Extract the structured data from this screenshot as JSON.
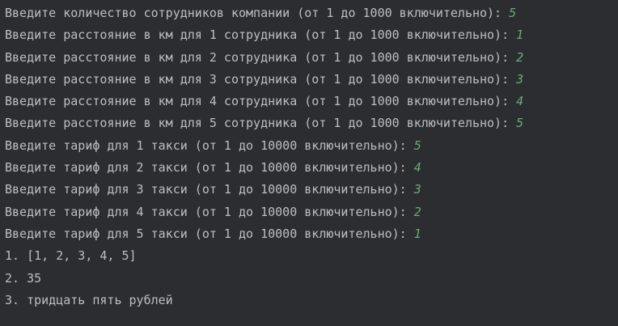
{
  "console": {
    "lines": [
      {
        "prompt": "Введите количество сотрудников компании (от 1 до 1000 включительно): ",
        "input": "5"
      },
      {
        "prompt": "Введите расстояние в км для 1 сотрудника (от 1 до 1000 включительно): ",
        "input": "1"
      },
      {
        "prompt": "Введите расстояние в км для 2 сотрудника (от 1 до 1000 включительно): ",
        "input": "2"
      },
      {
        "prompt": "Введите расстояние в км для 3 сотрудника (от 1 до 1000 включительно): ",
        "input": "3"
      },
      {
        "prompt": "Введите расстояние в км для 4 сотрудника (от 1 до 1000 включительно): ",
        "input": "4"
      },
      {
        "prompt": "Введите расстояние в км для 5 сотрудника (от 1 до 1000 включительно): ",
        "input": "5"
      },
      {
        "prompt": "Введите тариф для 1 такси (от 1 до 10000 включительно): ",
        "input": "5"
      },
      {
        "prompt": "Введите тариф для 2 такси (от 1 до 10000 включительно): ",
        "input": "4"
      },
      {
        "prompt": "Введите тариф для 3 такси (от 1 до 10000 включительно): ",
        "input": "3"
      },
      {
        "prompt": "Введите тариф для 4 такси (от 1 до 10000 включительно): ",
        "input": "2"
      },
      {
        "prompt": "Введите тариф для 5 такси (от 1 до 10000 включительно): ",
        "input": "1"
      }
    ],
    "results": [
      "1. [1, 2, 3, 4, 5]",
      "2. 35",
      "3. тридцать пять рублей"
    ],
    "colors": {
      "background": "#2b2d30",
      "text": "#bcbec4",
      "user_input": "#6aab73"
    }
  }
}
